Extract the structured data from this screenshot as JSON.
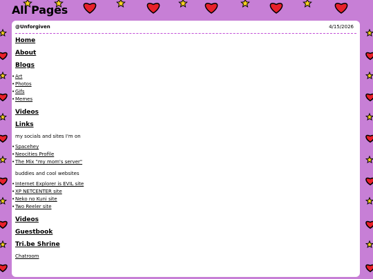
{
  "page": {
    "title": "All Pages"
  },
  "header": {
    "username": "@Unforgiven",
    "date": "4/15/2026"
  },
  "nav": {
    "home": "Home",
    "about": "About",
    "blogs": "Blogs",
    "blog_items": [
      "Art",
      "Photos",
      "Gifs",
      "Memes"
    ],
    "videos": "Videos",
    "links": "Links",
    "socials_text": "my socials and sites I'm on",
    "socials": [
      "Spacehey",
      "Neocities Profile",
      "The Mix \"my mom's server\""
    ],
    "buddies_text": "buddies and cool websites",
    "buddies": [
      "Internet Explorer is EVIL site",
      "XP NETCENTER site",
      "Neko no Kuni site",
      "Two Reeler site"
    ],
    "videos2": "Videos",
    "guestbook": "Guestbook",
    "shrine": "Tri.be Shrine",
    "chatroom": "Chatroom"
  },
  "colors": {
    "background": "#c77fd6",
    "dash_line": "#c04ad6",
    "heart": "#e8202a",
    "star": "#f5d020"
  }
}
